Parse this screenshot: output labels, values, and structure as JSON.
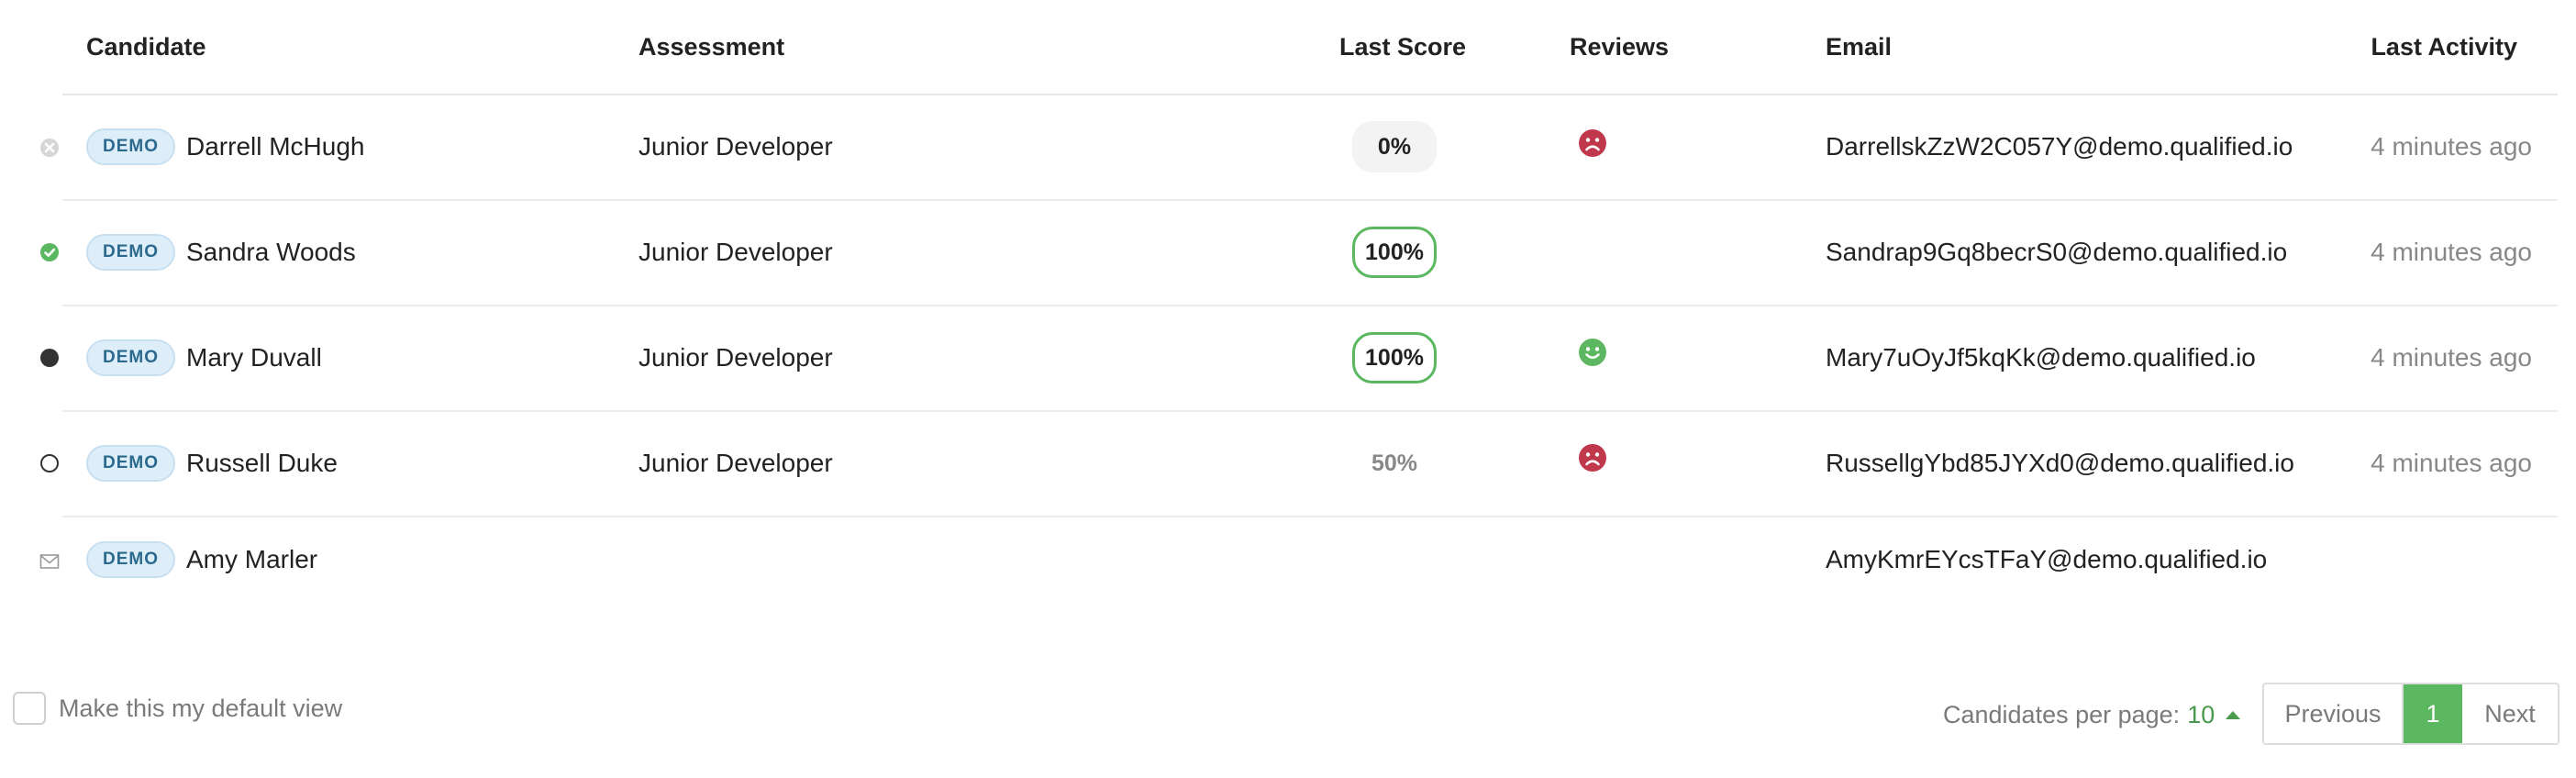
{
  "columns": {
    "candidate": "Candidate",
    "assessment": "Assessment",
    "last_score": "Last Score",
    "reviews": "Reviews",
    "email": "Email",
    "last_activity": "Last Activity"
  },
  "rows": [
    {
      "status": "archived-x-icon",
      "badge": "DEMO",
      "name": "Darrell McHugh",
      "assessment": "Junior Developer",
      "score": "0%",
      "score_style": "grey",
      "review": "sad-face-icon",
      "email": "DarrellskZzW2C057Y@demo.qualified.io",
      "activity": "4 minutes ago"
    },
    {
      "status": "completed-check-icon",
      "badge": "DEMO",
      "name": "Sandra Woods",
      "assessment": "Junior Developer",
      "score": "100%",
      "score_style": "green",
      "review": "",
      "email": "Sandrap9Gq8becrS0@demo.qualified.io",
      "activity": "4 minutes ago"
    },
    {
      "status": "filled-dot-icon",
      "badge": "DEMO",
      "name": "Mary Duvall",
      "assessment": "Junior Developer",
      "score": "100%",
      "score_style": "green",
      "review": "happy-face-icon",
      "email": "Mary7uOyJf5kqKk@demo.qualified.io",
      "activity": "4 minutes ago"
    },
    {
      "status": "empty-circle-icon",
      "badge": "DEMO",
      "name": "Russell Duke",
      "assessment": "Junior Developer",
      "score": "50%",
      "score_style": "plain",
      "review": "sad-face-icon",
      "email": "RussellgYbd85JYXd0@demo.qualified.io",
      "activity": "4 minutes ago"
    },
    {
      "status": "envelope-icon",
      "badge": "DEMO",
      "name": "Amy Marler",
      "assessment": "",
      "score": "",
      "score_style": "",
      "review": "",
      "email": "AmyKmrEYcsTFaY@demo.qualified.io",
      "activity": ""
    }
  ],
  "footer": {
    "default_view_label": "Make this my default view",
    "per_page_label": "Candidates per page:",
    "per_page_value": "10",
    "previous_label": "Previous",
    "current_page": "1",
    "next_label": "Next"
  },
  "colors": {
    "accent_green": "#5cb860",
    "sad_red": "#c0384c",
    "badge_bg": "#deeef8",
    "badge_text": "#2b6a8e"
  }
}
